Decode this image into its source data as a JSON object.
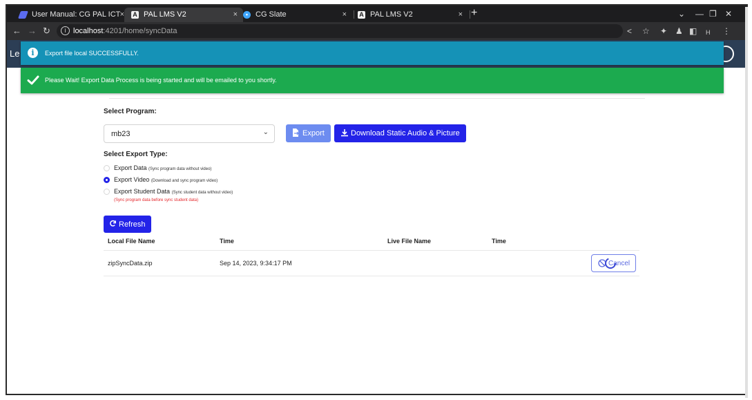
{
  "browser": {
    "tabs": [
      {
        "title": "User Manual: CG PAL ICT",
        "favicon": "user-manual-icon",
        "active": false
      },
      {
        "title": "PAL LMS V2",
        "favicon": "a-logo-icon",
        "active": true
      },
      {
        "title": "CG Slate",
        "favicon": "cg-slate-icon",
        "active": false
      },
      {
        "title": "PAL LMS V2",
        "favicon": "a-logo-icon",
        "active": false
      }
    ],
    "tab_close": "×",
    "new_tab": "+",
    "url_host": "localhost",
    "url_path": ":4201/home/syncData",
    "profile_initial": "H"
  },
  "app": {
    "brand_fragment": "Le"
  },
  "toasts": {
    "info": {
      "icon": "info-icon",
      "message": "Export file local SUCCESSFULLY.",
      "color": "#1592b7"
    },
    "success": {
      "icon": "checkmark-icon",
      "message": "Please Wait! Export Data Process is being started and will be emailed to you shortly.",
      "color": "#1caa4f"
    }
  },
  "form": {
    "program_label": "Select Program:",
    "program_value": "mb23",
    "export_button": "Export",
    "download_button": "Download Static Audio & Picture",
    "export_type_label": "Select Export Type:",
    "export_types": [
      {
        "label": "Export Data",
        "hint": "(Sync program data without video)",
        "checked": false
      },
      {
        "label": "Export Video",
        "hint": "(Download and sync program video)",
        "checked": true
      },
      {
        "label": "Export Student Data",
        "hint": "(Sync student data without video)",
        "checked": false
      }
    ],
    "student_warning": "(Sync program data before sync student data)",
    "refresh_button": "Refresh"
  },
  "table": {
    "headers": [
      "Local File Name",
      "Time",
      "Live File Name",
      "Time"
    ],
    "rows": [
      {
        "local_file": "zipSyncData.zip",
        "time": "Sep 14, 2023, 9:34:17 PM",
        "live_file": "",
        "live_time": "",
        "action": "Cancel"
      }
    ]
  },
  "colors": {
    "primary": "#2323e8",
    "export_button": "#6d8cf0",
    "warning_text": "#e4262b"
  }
}
